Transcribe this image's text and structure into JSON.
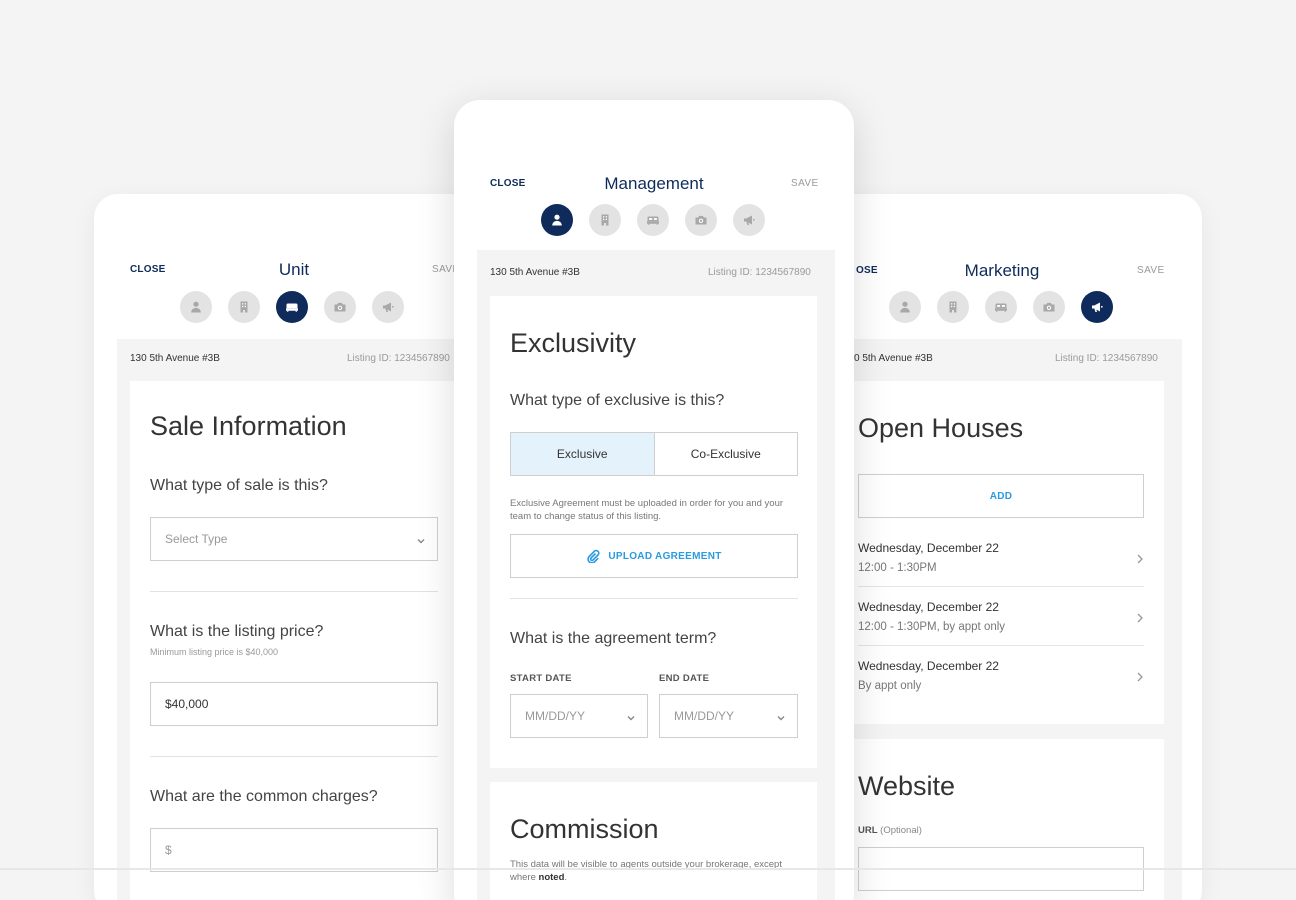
{
  "step_icons": [
    "agent-icon",
    "building-icon",
    "bed-icon",
    "camera-icon",
    "megaphone-icon"
  ],
  "colors": {
    "navy": "#0f2b5b",
    "link_blue": "#2a9be0",
    "selected_bg": "#e4f3fb"
  },
  "unit": {
    "close": "CLOSE",
    "title": "Unit",
    "save": "SAVE",
    "active_step": 2,
    "address": "130 5th Avenue #3B",
    "listing_id": "Listing ID: 1234567890",
    "heading": "Sale Information",
    "q_sale_type": "What type of sale is this?",
    "sale_type_placeholder": "Select Type",
    "q_price": "What is the listing price?",
    "price_hint": "Minimum listing price is $40,000",
    "price_value": "$40,000",
    "q_common": "What are the common charges?",
    "common_placeholder": "$"
  },
  "management": {
    "close": "CLOSE",
    "title": "Management",
    "save": "SAVE",
    "active_step": 0,
    "address": "130 5th Avenue #3B",
    "listing_id": "Listing ID: 1234567890",
    "heading": "Exclusivity",
    "q_exclusive": "What type of exclusive is this?",
    "option_exclusive": "Exclusive",
    "option_co_exclusive": "Co-Exclusive",
    "note": "Exclusive Agreement must be uploaded in order for you and your team to change status of this listing.",
    "upload_label": "UPLOAD AGREEMENT",
    "q_term": "What is the agreement term?",
    "start_label": "START DATE",
    "end_label": "END DATE",
    "start_placeholder": "MM/DD/YY",
    "end_placeholder": "MM/DD/YY",
    "commission_heading": "Commission",
    "commission_note_1": "This data will be visible to agents outside your brokerage, except where ",
    "commission_note_bold": "noted",
    "commission_note_2": "."
  },
  "marketing": {
    "close": "OSE",
    "title": "Marketing",
    "save": "SAVE",
    "active_step": 4,
    "address": "0 5th Avenue #3B",
    "listing_id": "Listing ID: 1234567890",
    "heading": "Open Houses",
    "add_label": "ADD",
    "open_houses": [
      {
        "date": "Wednesday, December 22",
        "time": "12:00 - 1:30PM"
      },
      {
        "date": "Wednesday, December 22",
        "time": "12:00 - 1:30PM, by appt only"
      },
      {
        "date": "Wednesday, December 22",
        "time": "By appt only"
      }
    ],
    "website_heading": "Website",
    "url_label": "URL",
    "url_optional": "(Optional)",
    "url_value": ""
  }
}
